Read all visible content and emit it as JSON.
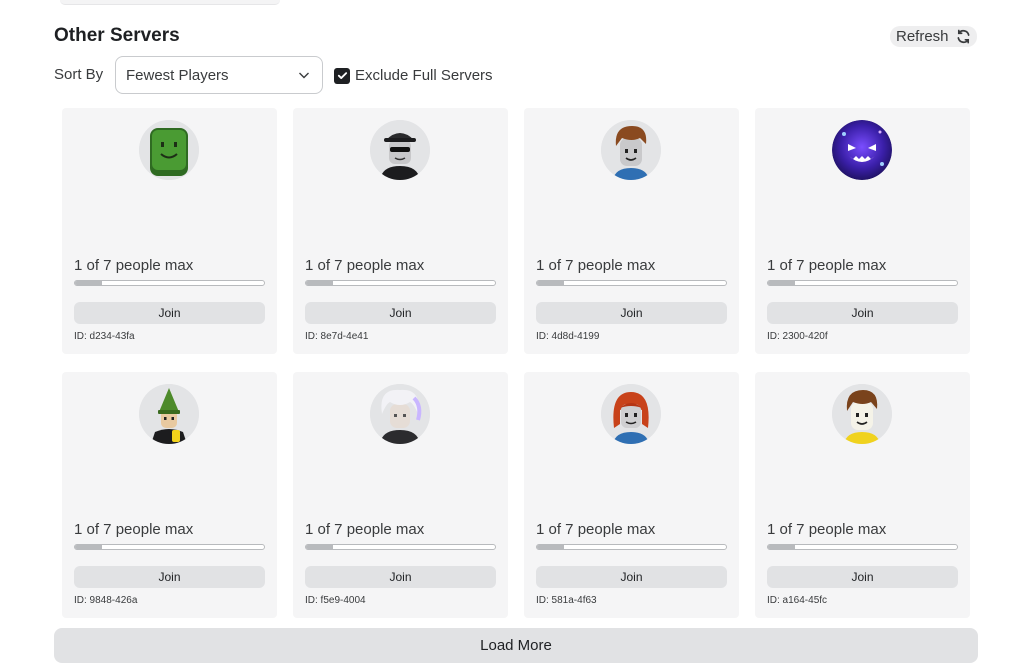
{
  "header": {
    "title": "Other Servers",
    "refresh_label": "Refresh",
    "refresh_icon": "refresh-icon"
  },
  "filters": {
    "sort_label": "Sort By",
    "sort_value": "Fewest Players",
    "exclude_label": "Exclude Full Servers",
    "exclude_checked": true
  },
  "colors": {
    "card_bg": "#f5f5f6",
    "button_bg": "#e1e2e4",
    "text": "#393b3d",
    "heading": "#1e2023"
  },
  "servers": [
    {
      "players_text": "1 of 7 people max",
      "fill": 0.143,
      "join_label": "Join",
      "id_text": "ID: d234-43fa",
      "avatar": "green-block-avatar"
    },
    {
      "players_text": "1 of 7 people max",
      "fill": 0.143,
      "join_label": "Join",
      "id_text": "ID: 8e7d-4e41",
      "avatar": "sunglasses-cap-avatar"
    },
    {
      "players_text": "1 of 7 people max",
      "fill": 0.143,
      "join_label": "Join",
      "id_text": "ID: 4d8d-4199",
      "avatar": "brown-hair-avatar"
    },
    {
      "players_text": "1 of 7 people max",
      "fill": 0.143,
      "join_label": "Join",
      "id_text": "ID: 2300-420f",
      "avatar": "purple-ghost-avatar"
    },
    {
      "players_text": "1 of 7 people max",
      "fill": 0.143,
      "join_label": "Join",
      "id_text": "ID: 9848-426a",
      "avatar": "green-hat-avatar"
    },
    {
      "players_text": "1 of 7 people max",
      "fill": 0.143,
      "join_label": "Join",
      "id_text": "ID: f5e9-4004",
      "avatar": "white-hair-avatar"
    },
    {
      "players_text": "1 of 7 people max",
      "fill": 0.143,
      "join_label": "Join",
      "id_text": "ID: 581a-4f63",
      "avatar": "red-hair-avatar"
    },
    {
      "players_text": "1 of 7 people max",
      "fill": 0.143,
      "join_label": "Join",
      "id_text": "ID: a164-45fc",
      "avatar": "brown-hair-yellow-shirt-avatar"
    }
  ],
  "footer": {
    "load_more_label": "Load More"
  }
}
